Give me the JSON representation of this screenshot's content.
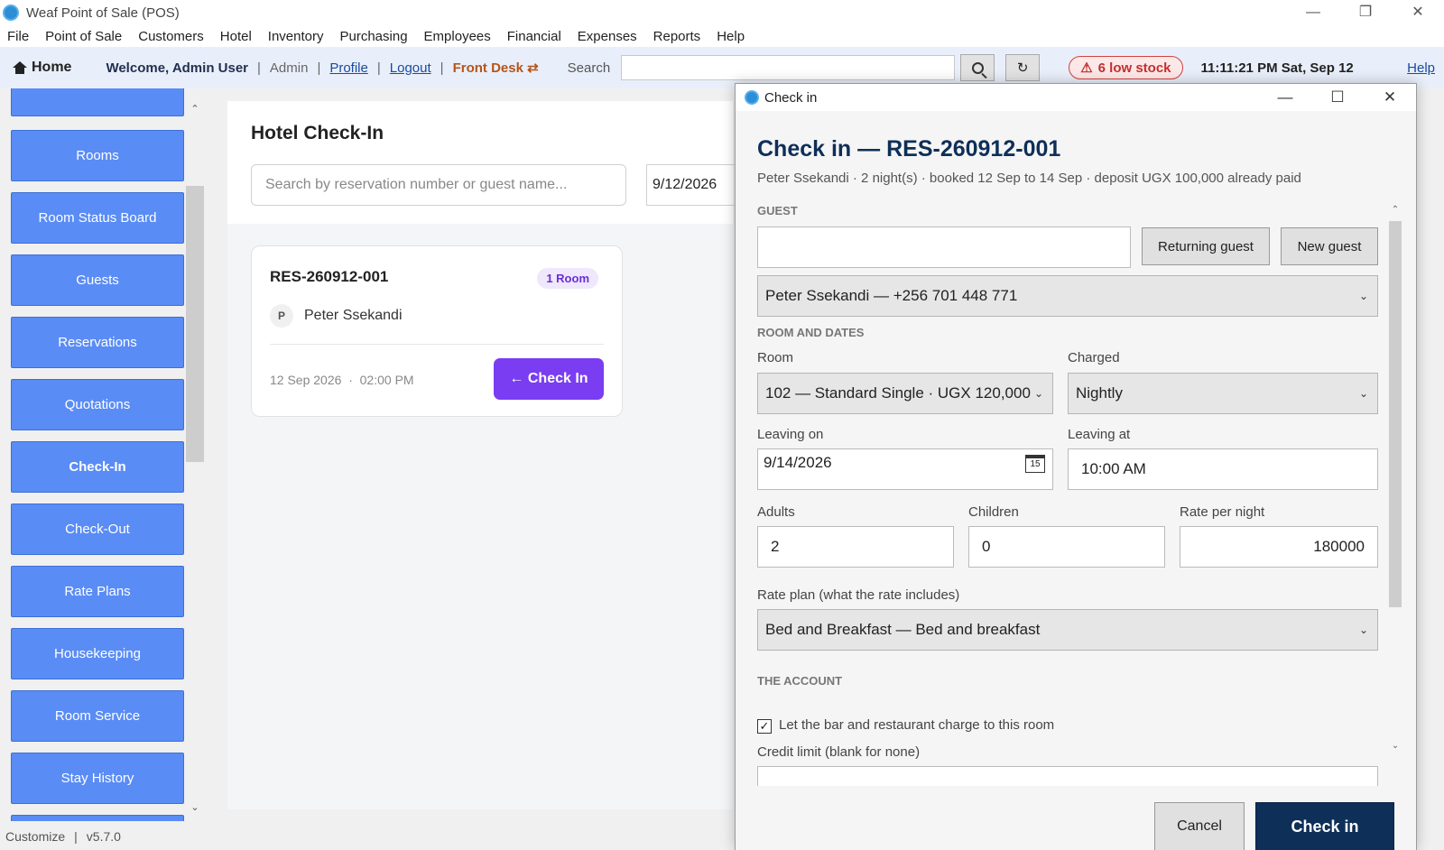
{
  "app": {
    "title": "Weaf Point of Sale (POS)"
  },
  "window_controls": {
    "minimize": "—",
    "restore": "❐",
    "close": "✕"
  },
  "menu": [
    "File",
    "Point of Sale",
    "Customers",
    "Hotel",
    "Inventory",
    "Purchasing",
    "Employees",
    "Financial",
    "Expenses",
    "Reports",
    "Help"
  ],
  "toolbar": {
    "home": "Home",
    "welcome": "Welcome, Admin User",
    "sep": "|",
    "role": "Admin",
    "profile": "Profile",
    "logout": "Logout",
    "front_desk": "Front Desk ⇄",
    "search_label": "Search",
    "search_value": "",
    "refresh_icon": "↻",
    "low_stock_icon": "⚠",
    "low_stock": "6 low stock",
    "clock": "11:11:21 PM Sat, Sep 12",
    "help": "Help"
  },
  "sidebar": {
    "items": [
      {
        "label": "Rooms",
        "active": false
      },
      {
        "label": "Room Status Board",
        "active": false
      },
      {
        "label": "Guests",
        "active": false
      },
      {
        "label": "Reservations",
        "active": false
      },
      {
        "label": "Quotations",
        "active": false
      },
      {
        "label": "Check-In",
        "active": true
      },
      {
        "label": "Check-Out",
        "active": false
      },
      {
        "label": "Rate Plans",
        "active": false
      },
      {
        "label": "Housekeeping",
        "active": false
      },
      {
        "label": "Room Service",
        "active": false
      },
      {
        "label": "Stay History",
        "active": false
      }
    ],
    "scroll_up": "⌃",
    "scroll_down": "⌄"
  },
  "main": {
    "title": "Hotel Check-In",
    "search_placeholder": "Search by reservation number or guest name...",
    "date": "9/12/2026",
    "card": {
      "number": "RES-260912-001",
      "rooms_badge": "1 Room",
      "guest_initial": "P",
      "guest_name": "Peter Ssekandi",
      "date": "12 Sep 2026",
      "time_sep": "·",
      "time": "02:00 PM",
      "button": "← Check In"
    }
  },
  "statusbar": {
    "customize": "Customize",
    "sep": "|",
    "version": "v5.7.0"
  },
  "dialog": {
    "window_title": "Check in",
    "heading": "Check in — RES-260912-001",
    "subtitle": "Peter Ssekandi · 2 night(s) · booked 12 Sep to 14 Sep · deposit UGX 100,000 already paid",
    "guest_section": "GUEST",
    "guest_search_value": "",
    "returning_guest": "Returning guest",
    "new_guest": "New guest",
    "guest_select": "Peter Ssekandi — +256 701 448 771",
    "room_section": "ROOM AND DATES",
    "room_label": "Room",
    "room_value": "102 — Standard Single · UGX 120,000 /",
    "charged_label": "Charged",
    "charged_value": "Nightly",
    "leaving_on_label": "Leaving on",
    "leaving_on_value": "9/14/2026",
    "calendar_day": "15",
    "leaving_at_label": "Leaving at",
    "leaving_at_value": "10:00 AM",
    "adults_label": "Adults",
    "adults_value": "2",
    "children_label": "Children",
    "children_value": "0",
    "rate_label": "Rate per night",
    "rate_value": "180000",
    "rate_plan_label": "Rate plan (what the rate includes)",
    "rate_plan_value": "Bed and Breakfast — Bed and breakfast",
    "account_section": "THE ACCOUNT",
    "charge_checked": true,
    "charge_label": "Let the bar and restaurant charge to this room",
    "credit_label": "Credit limit (blank for none)",
    "credit_value": "",
    "cancel": "Cancel",
    "confirm": "Check in"
  }
}
